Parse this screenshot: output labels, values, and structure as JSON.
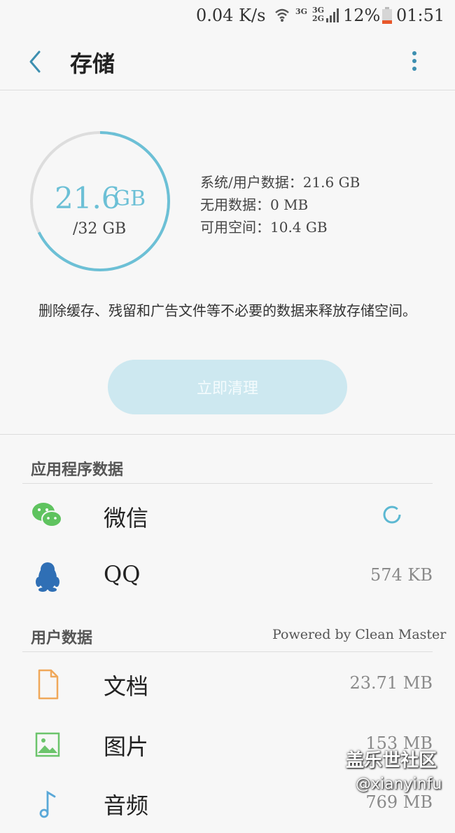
{
  "status_bar": {
    "speed": "0.04 K/s",
    "net1": "3G",
    "net2_top": "3G",
    "net2_bottom": "2G",
    "battery": "12%",
    "time": "01:51",
    "icons": [
      "wifi-icon",
      "signal-icon",
      "battery-low-icon"
    ],
    "battery_color": "#e8572a"
  },
  "header": {
    "back_icon": "chevron-left-icon",
    "title": "存储",
    "menu_icon": "more-vertical-icon"
  },
  "storage": {
    "used_value": "21.6",
    "used_unit": "GB",
    "total": "/32 GB",
    "used_fraction": 0.675,
    "ring_color": "#6cc0d6",
    "ring_track_color": "#dddddd",
    "details": [
      "系统/用户数据：21.6 GB",
      "无用数据：0 MB",
      "可用空间：10.4 GB"
    ],
    "hint": "删除缓存、残留和广告文件等不必要的数据来释放存储空间。",
    "clean_button": "立即清理"
  },
  "app_data": {
    "title": "应用程序数据",
    "items": [
      {
        "name": "微信",
        "icon": "wechat-icon",
        "size": "",
        "loading": true
      },
      {
        "name": "QQ",
        "icon": "qq-penguin-icon",
        "size": "574 KB"
      }
    ]
  },
  "user_data": {
    "title": "用户数据",
    "powered": "Powered by Clean Master",
    "items": [
      {
        "name": "文档",
        "icon": "document-icon",
        "size": "23.71 MB",
        "color": "#f0a85a"
      },
      {
        "name": "图片",
        "icon": "image-icon",
        "size": "153 MB",
        "color": "#6cc46c"
      },
      {
        "name": "音频",
        "icon": "music-note-icon",
        "size": "769 MB",
        "color": "#5aa8d8"
      }
    ]
  },
  "watermark": {
    "line1": "盖乐世社区",
    "line2": "@xianyinfu"
  }
}
